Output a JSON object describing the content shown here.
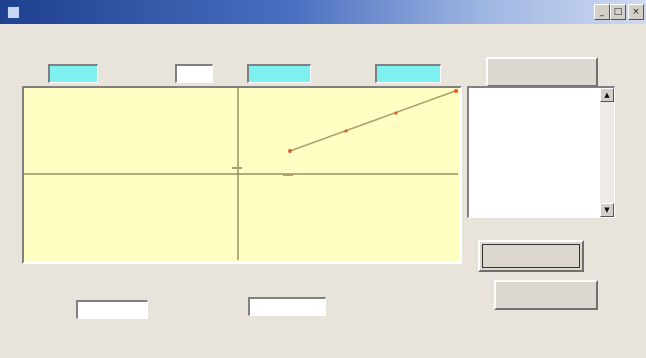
{
  "window": {
    "title": "",
    "minimize_label": "_",
    "maximize_label": "□",
    "close_label": "×"
  },
  "labels": {
    "header_1": "",
    "header_2": "",
    "header_3": "",
    "header_4": "",
    "middle_label": "",
    "bottom_left_label": "",
    "bottom_right_label": ""
  },
  "fields": {
    "field_1": "",
    "field_2": "",
    "field_3": "",
    "field_4": "",
    "bottom_left": "",
    "bottom_right": ""
  },
  "buttons": {
    "top_right": "",
    "calculate": "",
    "bottom_right": ""
  },
  "list": {
    "items": [
      "",
      "",
      "",
      "",
      ""
    ]
  },
  "status_text": "",
  "colors": {
    "plot_background": "#ffffc4",
    "line": "#b0a068",
    "point": "#e06030",
    "axis": "#7a7a50",
    "cyan_field": "#7ff0f0"
  },
  "icons": {
    "scroll_up": "▲",
    "scroll_down": "▼"
  }
}
